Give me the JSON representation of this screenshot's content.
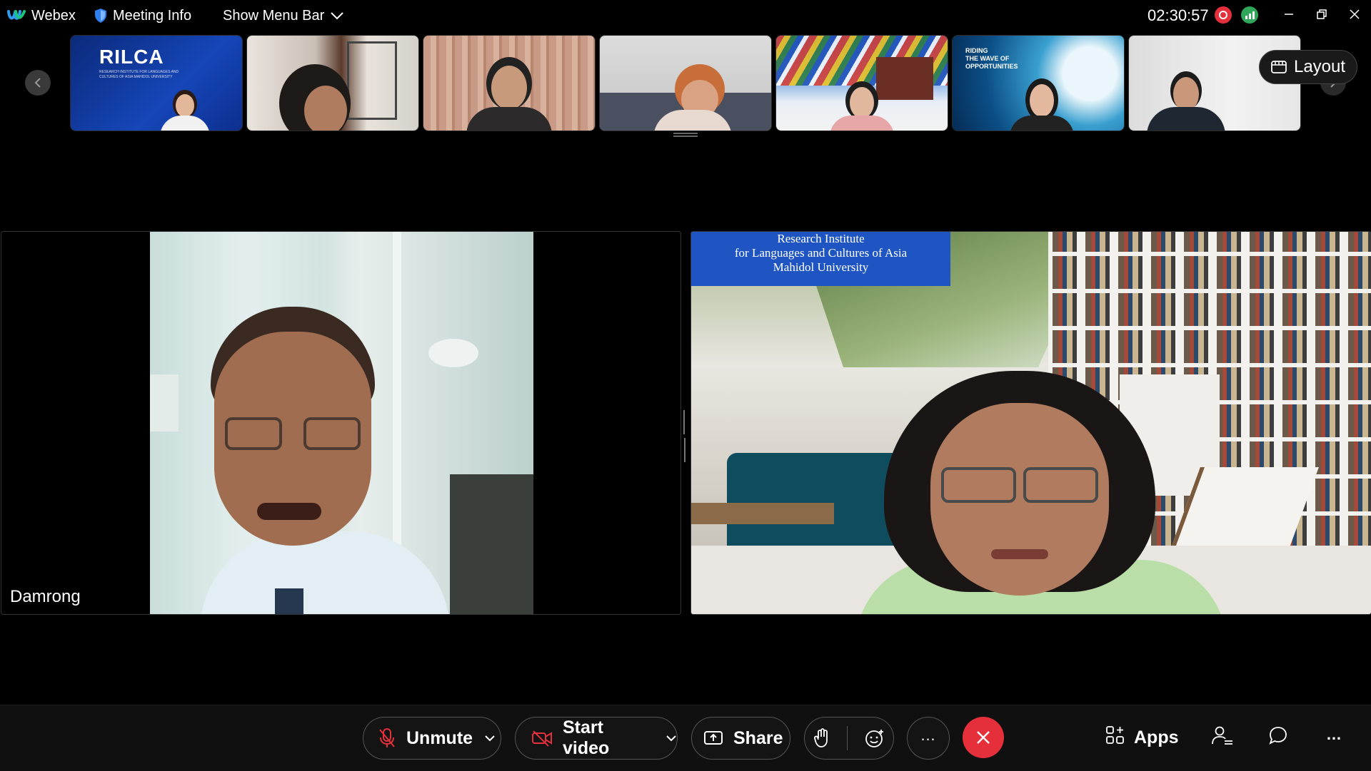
{
  "app": {
    "name": "Webex",
    "meeting_info": "Meeting Info",
    "show_menu_bar": "Show Menu Bar",
    "timer": "02:30:57",
    "record_color": "#e5303b",
    "stats_color": "#2ea75a"
  },
  "filmstrip": {
    "layout_label": "Layout",
    "thumb1": {
      "logo": "RILCA",
      "caption": "RESEARCH INSTITUTE FOR LANGUAGES AND CULTURES OF ASIA MAHIDOL UNIVERSITY"
    },
    "thumb6": {
      "caption_line1": "RIDING",
      "caption_line2": "THE WAVE OF",
      "caption_line3": "OPPORTUNITIES"
    }
  },
  "main": {
    "left_tile": {
      "name": "Damrong"
    },
    "right_tile": {
      "banner_line1": "Research Institute",
      "banner_line2": "for Languages and Cultures of Asia",
      "banner_line3": "Mahidol University"
    }
  },
  "toolbar": {
    "unmute": "Unmute",
    "start_video": "Start video",
    "share": "Share",
    "more": "…",
    "apps": "Apps",
    "overflow": "…"
  },
  "colors": {
    "accent_red": "#e5303b",
    "banner_blue": "#1f55c2",
    "layout_btn_bg": "#1a1a1a"
  }
}
